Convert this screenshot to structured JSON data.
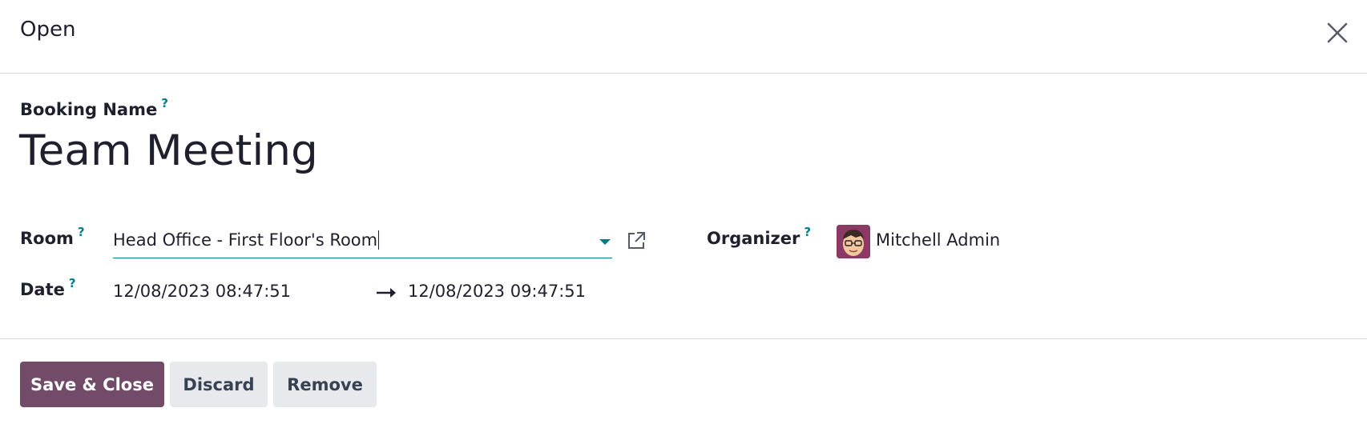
{
  "dialog": {
    "title": "Open"
  },
  "form": {
    "booking_name_label": "Booking Name",
    "booking_name_value": "Team Meeting",
    "help_marker": "?",
    "room_label": "Room",
    "room_value": "Head Office - First Floor's Room",
    "date_label": "Date",
    "date_start": "12/08/2023 08:47:51",
    "date_end": "12/08/2023 09:47:51",
    "organizer_label": "Organizer",
    "organizer_name": "Mitchell Admin"
  },
  "footer": {
    "save_label": "Save & Close",
    "discard_label": "Discard",
    "remove_label": "Remove"
  },
  "icons": {
    "close": "close-icon",
    "dropdown": "chevron-down-icon",
    "external_link": "external-link-icon",
    "arrow": "arrow-right-icon",
    "avatar": "avatar"
  },
  "colors": {
    "primary": "#714b67",
    "accent": "#017e84",
    "secondary_button": "#e7e9ed",
    "text": "#1f1f2e",
    "divider": "#d8dadd"
  }
}
